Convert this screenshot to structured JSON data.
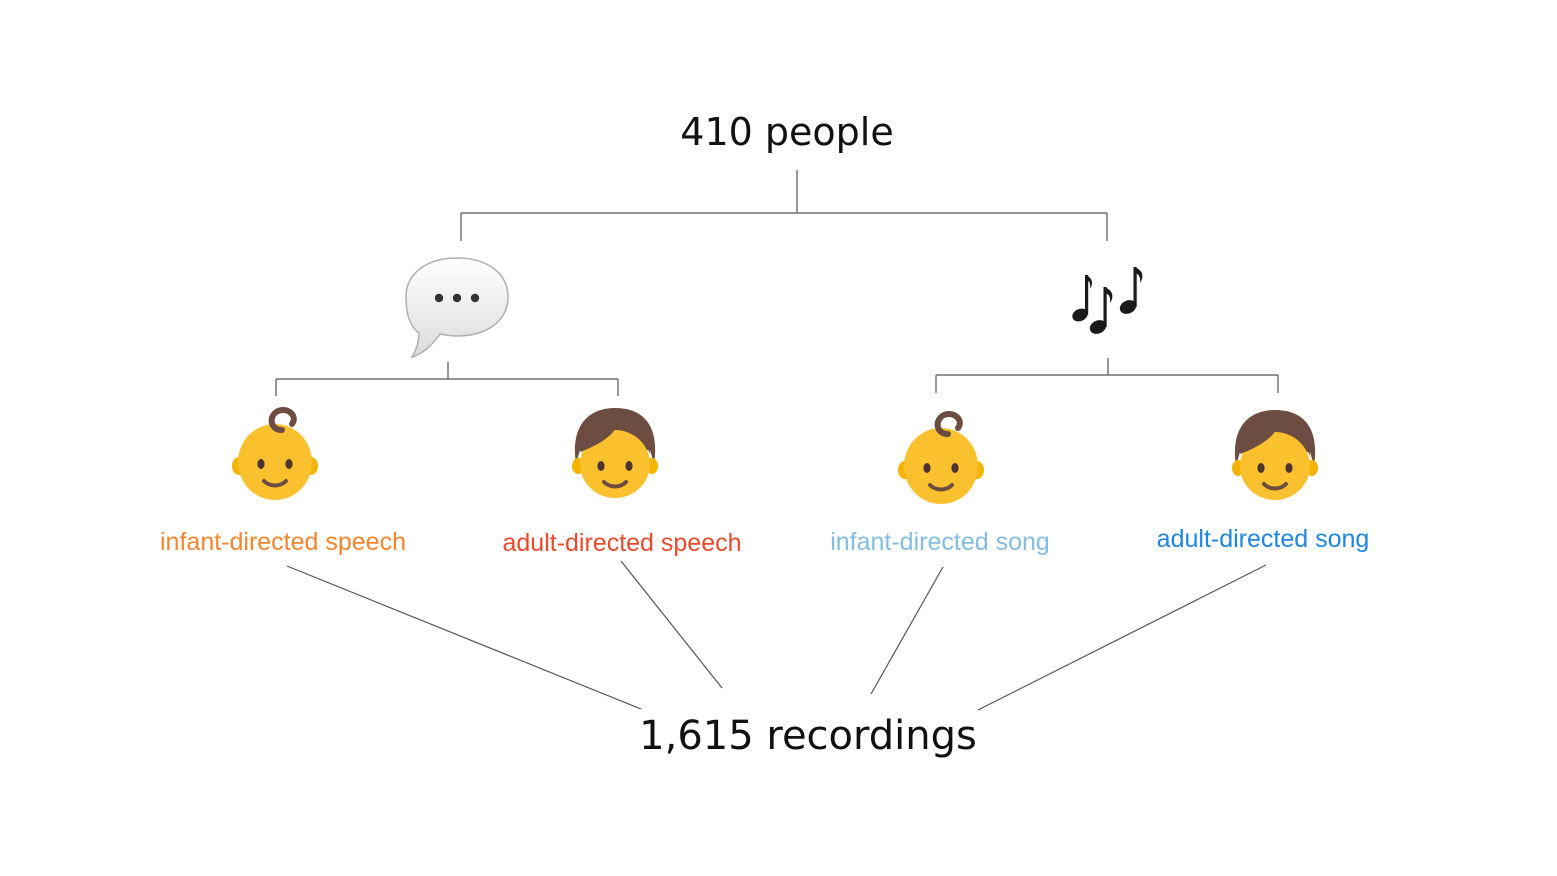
{
  "top": {
    "title": "410 people"
  },
  "bottom": {
    "title": "1,615 recordings"
  },
  "branches": [
    {
      "icon": "speech-bubble-icon"
    },
    {
      "icon": "musical-notes-icon"
    }
  ],
  "leaves": [
    {
      "label": "infant-directed speech",
      "icon": "baby-icon",
      "color": "#F5862E"
    },
    {
      "label": "adult-directed speech",
      "icon": "child-icon",
      "color": "#EB4A2B"
    },
    {
      "label": "infant-directed song",
      "icon": "baby-icon",
      "color": "#83BDE2"
    },
    {
      "label": "adult-directed song",
      "icon": "child-icon",
      "color": "#1E86E6"
    }
  ]
}
